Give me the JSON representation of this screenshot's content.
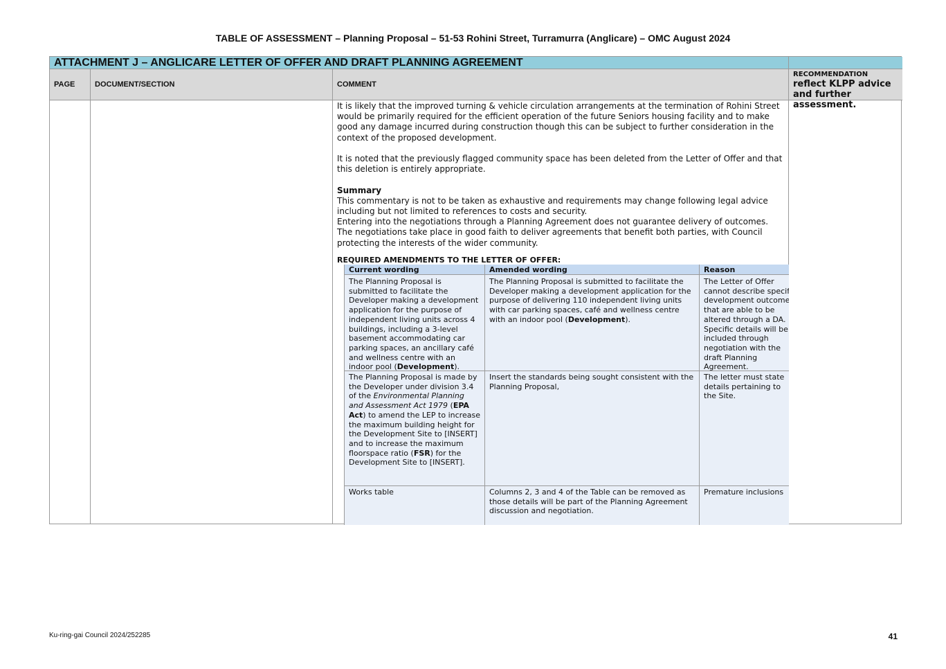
{
  "doc_title": "TABLE OF ASSESSMENT – Planning Proposal – 51-53 Rohini Street, Turramurra (Anglicare) – OMC August 2024",
  "attachment_title": "ATTACHMENT J – ANGLICARE LETTER OF OFFER AND DRAFT PLANNING AGREEMENT",
  "headers": {
    "page": "PAGE",
    "document_section": "DOCUMENT/SECTION",
    "comment": "COMMENT",
    "recommendation_label": "RECOMMENDATION",
    "recommendation_text": "reflect KLPP advice and further assessment."
  },
  "comment": {
    "para1": "It is likely that the improved turning & vehicle circulation arrangements at the termination of Rohini Street would be primarily required for the efficient operation of the future Seniors housing facility and to make good any damage incurred during construction though this can be subject to further consideration in the context of the proposed development.",
    "para2": "It is noted that the previously flagged community space has been deleted from the Letter of Offer and that this deletion is entirely appropriate.",
    "summary_heading": "Summary",
    "summary_1": "This commentary is not to be taken as exhaustive and requirements may change following legal advice including but not limited to references to costs and security.",
    "summary_2": "Entering into the negotiations through a Planning Agreement does not guarantee delivery of outcomes. The negotiations take place in good faith to deliver agreements that benefit both parties, with Council protecting the interests of the wider community.",
    "required_heading": "REQUIRED AMENDMENTS TO THE LETTER OF OFFER:"
  },
  "amendments": {
    "columns": [
      "Current wording",
      "Amended wording",
      "Reason"
    ],
    "row1": {
      "current_a": "The Planning Proposal is submitted to facilitate the Developer making a development application for the purpose of independent living units across 4 buildings, including a 3-level basement accommodating car parking spaces, an ancillary café and wellness centre with an indoor pool (",
      "current_bold": "Development",
      "current_b": ").",
      "amended_a": "The Planning Proposal is submitted to facilitate the Developer making a development application for the purpose of delivering 110 independent living units with car parking spaces, café and wellness centre with an indoor pool (",
      "amended_bold": "Development",
      "amended_b": ").",
      "reason": "The Letter of Offer cannot describe specific development outcomes that are able to be altered through a DA. Specific details will be included through negotiation with the draft Planning Agreement."
    },
    "row2": {
      "current_1": "The Planning Proposal is made by the Developer under division 3.4 of the ",
      "current_italic": "Environmental Planning and Assessment Act 1979",
      "current_2": " (",
      "current_bold1": "EPA Act",
      "current_3": ") to amend the LEP to increase the maximum building height for the Development Site to [INSERT] and to increase the maximum floorspace ratio (",
      "current_bold2": "FSR",
      "current_4": ") for the Development Site to [INSERT].",
      "amended": "Insert the standards being sought consistent with the Planning Proposal,",
      "reason": "The letter must state details pertaining to the Site."
    },
    "row3": {
      "current": "Works table",
      "amended": "Columns 2, 3 and 4 of the Table can be removed as those details will be part of the Planning Agreement discussion and negotiation.",
      "reason": "Premature inclusions"
    }
  },
  "footer": {
    "reference": "Ku-ring-gai Council 2024/252285",
    "page_number": "41"
  }
}
